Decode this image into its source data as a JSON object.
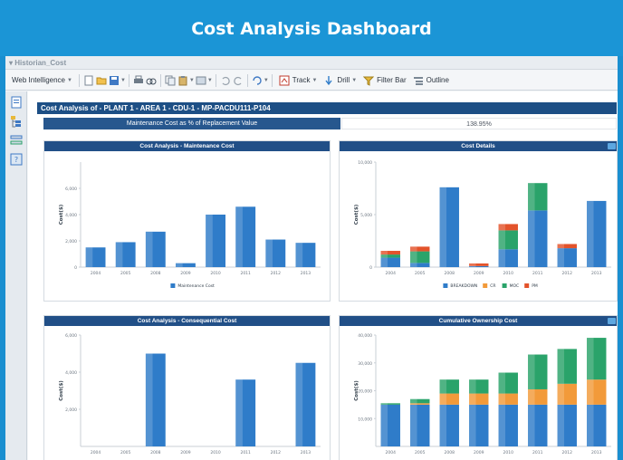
{
  "banner": {
    "title": "Cost Analysis Dashboard"
  },
  "app": {
    "header": "▾ Historian_Cost"
  },
  "toolbar": {
    "web_intelligence": "Web Intelligence",
    "track": "Track",
    "drill": "Drill",
    "filter_bar": "Filter Bar",
    "outline": "Outline"
  },
  "report": {
    "title": "Cost Analysis of - PLANT 1 - AREA 1 - CDU-1 - MP-PACDU111-P104",
    "kpi_label": "Maintenance Cost as % of Replacement Value",
    "kpi_value": "138.95%"
  },
  "colors": {
    "breakdown": "#2f7cc9",
    "cr": "#f29a3a",
    "moc": "#2aa36a",
    "pm": "#e3532b",
    "header_blue": "#214f87"
  },
  "chart_data": [
    {
      "type": "bar",
      "title": "Cost Analysis - Maintenance Cost",
      "ylabel": "Cost($)",
      "ylim": [
        0,
        8000
      ],
      "yticks": [
        "0",
        "2,000",
        "4,000",
        "6,000"
      ],
      "categories": [
        "2004",
        "2005",
        "2008",
        "2009",
        "2010",
        "2011",
        "2012",
        "2013"
      ],
      "series": [
        {
          "name": "Maintenance Cost",
          "values": [
            1500,
            1900,
            2700,
            300,
            4000,
            4600,
            2100,
            1850
          ]
        }
      ],
      "legend": "bottom"
    },
    {
      "type": "bar",
      "stacked": true,
      "title": "Cost Details",
      "ylabel": "Cost($)",
      "ylim": [
        0,
        10000
      ],
      "yticks": [
        "0",
        "5,000",
        "10,000"
      ],
      "categories": [
        "2004",
        "2005",
        "2008",
        "2009",
        "2010",
        "2011",
        "2012",
        "2013"
      ],
      "series": [
        {
          "name": "BREAKDOWN",
          "values": [
            900,
            400,
            7600,
            100,
            1700,
            5400,
            1800,
            6300
          ]
        },
        {
          "name": "CR",
          "values": [
            0,
            0,
            0,
            0,
            0,
            0,
            0,
            0
          ]
        },
        {
          "name": "MOC",
          "values": [
            300,
            1100,
            0,
            0,
            1800,
            2600,
            0,
            0
          ]
        },
        {
          "name": "PM",
          "values": [
            350,
            450,
            0,
            250,
            600,
            0,
            400,
            0
          ]
        }
      ],
      "legend": "bottom"
    },
    {
      "type": "bar",
      "title": "Cost Analysis - Consequential Cost",
      "ylabel": "Cost($)",
      "ylim": [
        0,
        6000
      ],
      "yticks": [
        "2,000",
        "4,000",
        "6,000"
      ],
      "categories": [
        "2004",
        "2005",
        "2008",
        "2009",
        "2010",
        "2011",
        "2012",
        "2013"
      ],
      "series": [
        {
          "name": "",
          "values": [
            0,
            0,
            5000,
            0,
            0,
            3600,
            0,
            4500
          ]
        }
      ]
    },
    {
      "type": "bar",
      "stacked": true,
      "title": "Cumulative Ownership Cost",
      "ylabel": "Cost($)",
      "ylim": [
        0,
        40000
      ],
      "yticks": [
        "10,000",
        "20,000",
        "30,000",
        "40,000"
      ],
      "categories": [
        "2004",
        "2005",
        "2008",
        "2009",
        "2010",
        "2011",
        "2012",
        "2013"
      ],
      "series": [
        {
          "name": "BREAKDOWN",
          "values": [
            15000,
            15000,
            15000,
            15000,
            15000,
            15000,
            15000,
            15000
          ]
        },
        {
          "name": "CR",
          "values": [
            0,
            500,
            4000,
            4000,
            4000,
            5500,
            7500,
            9000
          ]
        },
        {
          "name": "MOC",
          "values": [
            500,
            1500,
            5000,
            5000,
            7500,
            12500,
            12500,
            15000
          ]
        }
      ]
    }
  ]
}
